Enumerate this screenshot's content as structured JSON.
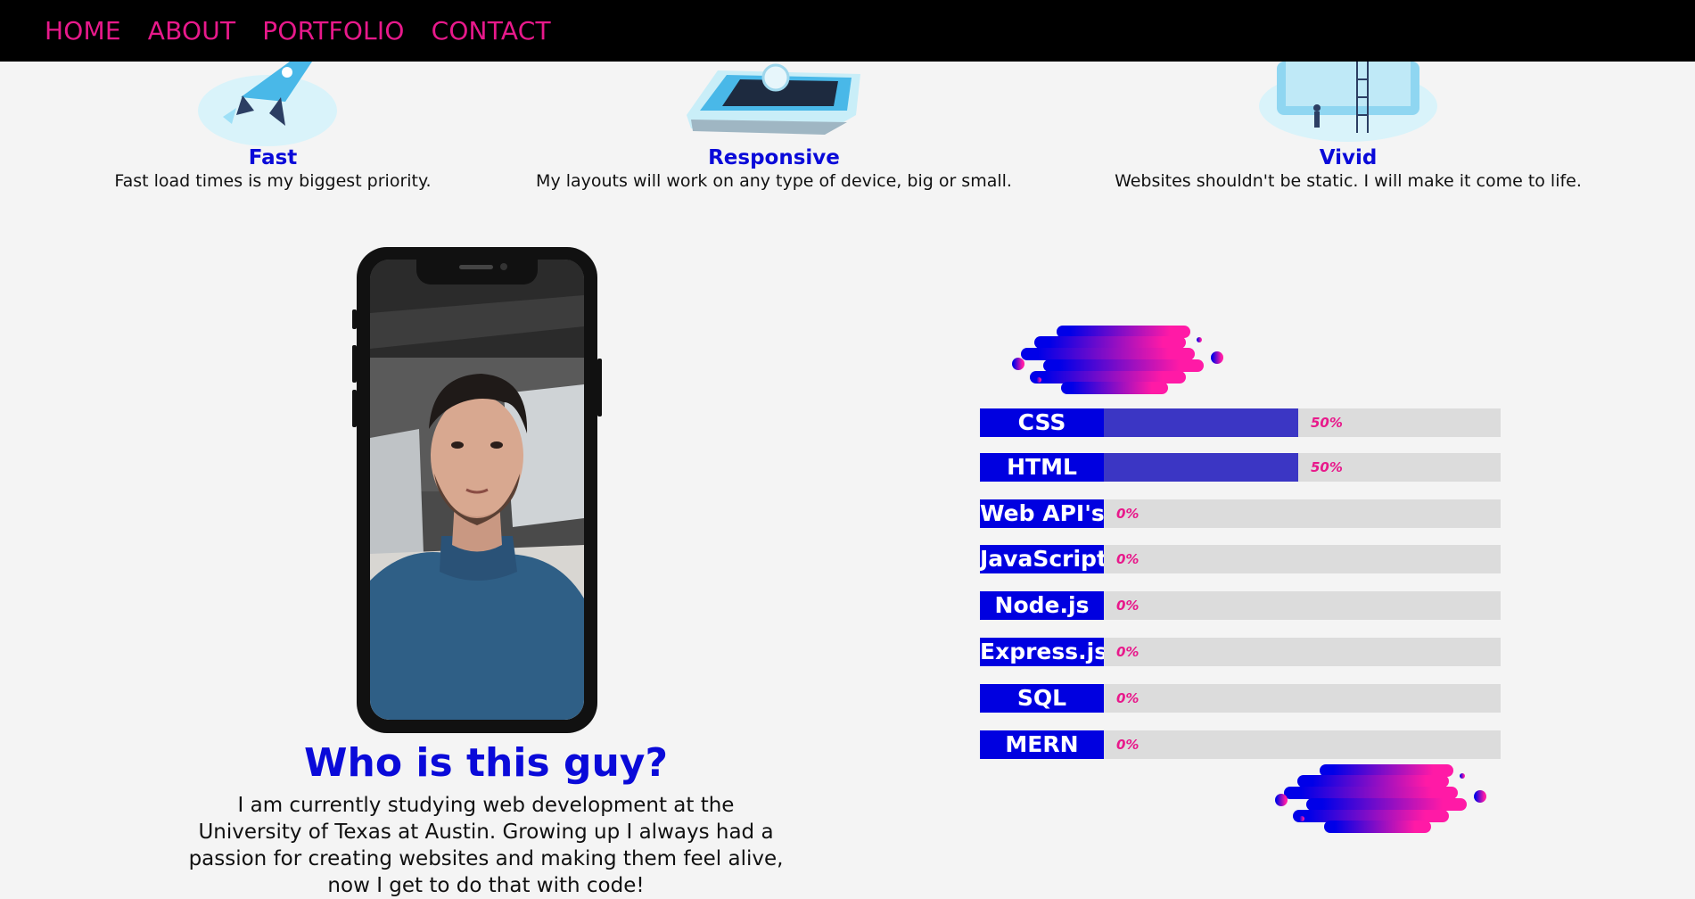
{
  "nav": {
    "links": [
      "HOME",
      "ABOUT",
      "PORTFOLIO",
      "CONTACT"
    ]
  },
  "features": [
    {
      "title": "Fast",
      "desc": "Fast load times is my biggest priority.",
      "icon": "rocket-illustration"
    },
    {
      "title": "Responsive",
      "desc": "My layouts will work on any type of device, big or small.",
      "icon": "tablet-illustration"
    },
    {
      "title": "Vivid",
      "desc": "Websites shouldn't be static. I will make it come to life.",
      "icon": "monitor-illustration"
    }
  ],
  "about": {
    "title": "Who is this guy?",
    "text": "I am currently studying web development at the University of Texas at Austin. Growing up I always had a passion for creating websites and making them feel alive, now I get to do that with code!"
  },
  "skills": [
    {
      "name": "CSS",
      "pct_label": "50%",
      "value": 0.5
    },
    {
      "name": "HTML",
      "pct_label": "50%",
      "value": 0.5
    },
    {
      "name": "Web API's",
      "pct_label": "0%",
      "value": 0
    },
    {
      "name": "JavaScript",
      "pct_label": "0%",
      "value": 0
    },
    {
      "name": "Node.js",
      "pct_label": "0%",
      "value": 0
    },
    {
      "name": "Express.js",
      "pct_label": "0%",
      "value": 0
    },
    {
      "name": "SQL",
      "pct_label": "0%",
      "value": 0
    },
    {
      "name": "MERN",
      "pct_label": "0%",
      "value": 0
    }
  ],
  "colors": {
    "accent_pink": "#e8198b",
    "accent_blue": "#0a0ad9",
    "bar_fill": "#3b36c4",
    "nav_bg": "#000000"
  }
}
